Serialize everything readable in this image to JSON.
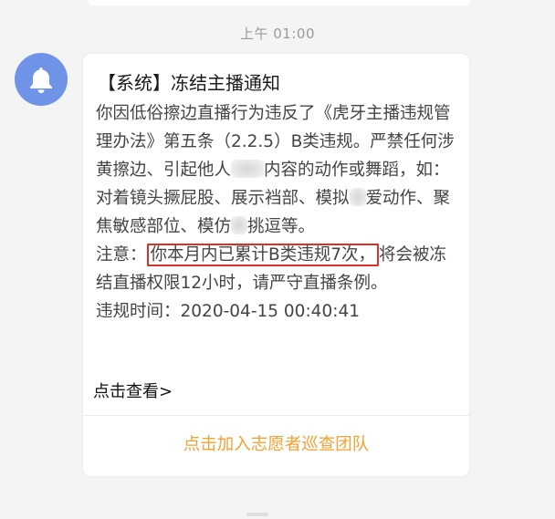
{
  "timestamp": "上午 01:00",
  "avatar": {
    "icon": "bell-icon",
    "color": "#6f93e6"
  },
  "card": {
    "title": "【系统】冻结主播通知",
    "para1_part1": "你因低俗擦边直播行为违反了《虎牙主播违规管理办法》第五条（2.2.5）B类违规。严禁任何涉黄擦边、引起他人",
    "para1_part2": "内容的动作或舞蹈，如：对着镜头撅屁股、展示裆部、模拟",
    "para1_part3": "爱动作、聚焦敏感部位、模仿",
    "para1_part4": "挑逗等。",
    "notice_label": "注意：",
    "notice_highlight": "你本月内已累计B类违规7次，",
    "notice_rest": "将会被冻结直播权限12小时，请严守直播条例。",
    "violation_time_label": "违规时间：",
    "violation_time_value": "2020-04-15 00:40:41",
    "view_more": "点击查看>",
    "volunteer_link": "点击加入志愿者巡查团队"
  },
  "colors": {
    "highlight_border": "#d9302a",
    "link": "#f3a233"
  }
}
